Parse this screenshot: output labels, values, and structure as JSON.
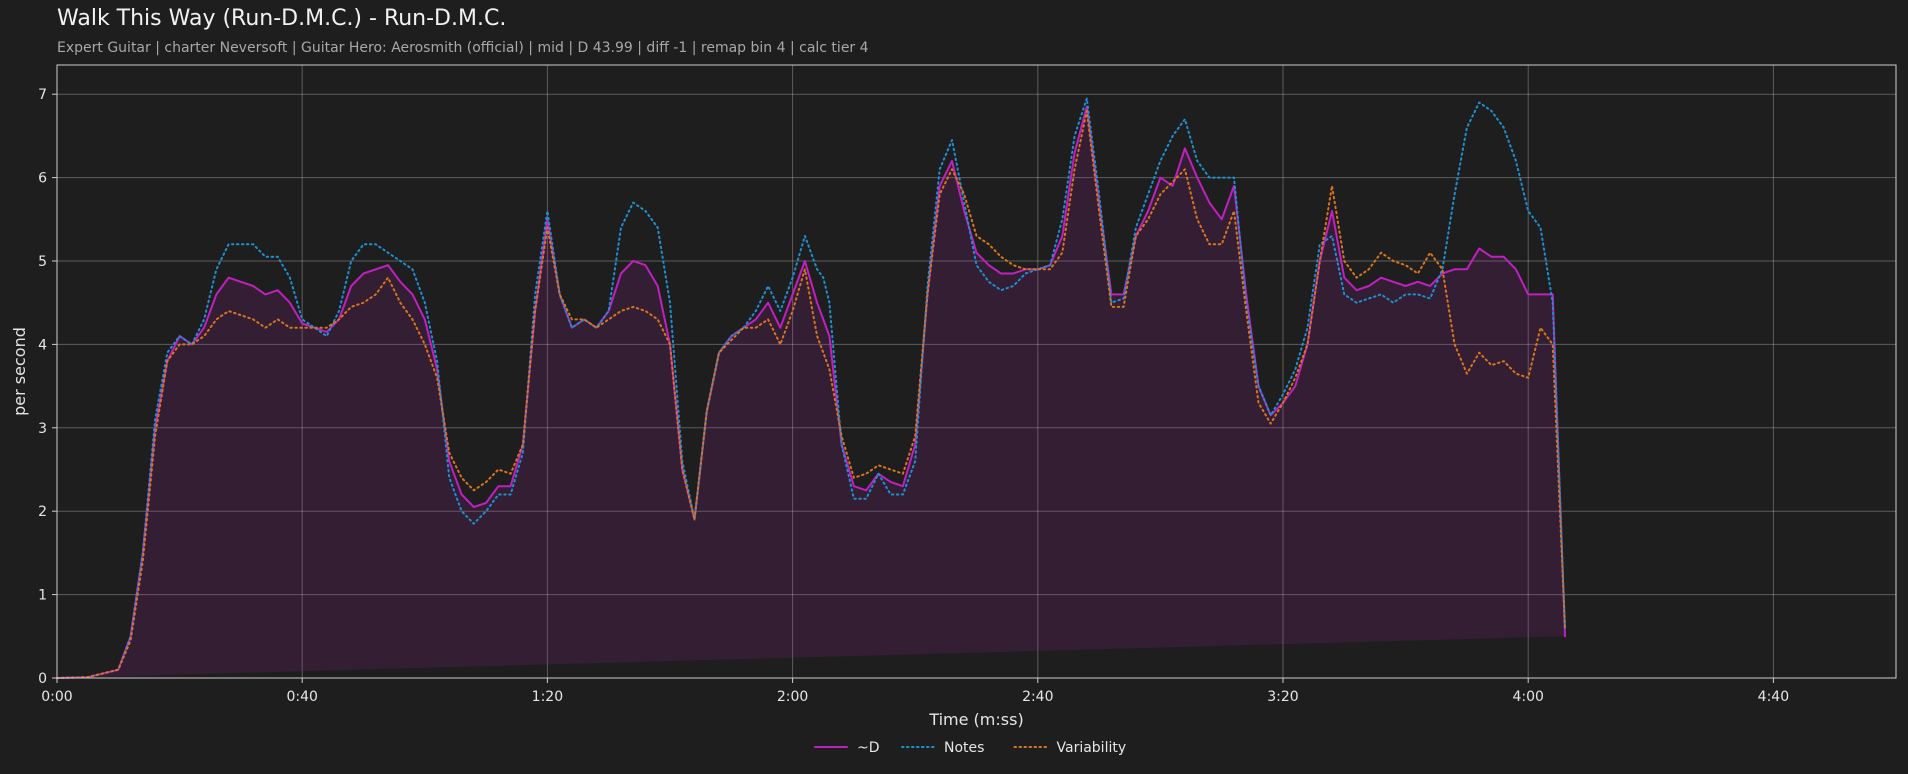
{
  "title": "Walk This Way (Run-D.M.C.) - Run-D.M.C.",
  "subtitle": "Expert Guitar  |  charter Neversoft  |  Guitar Hero: Aerosmith (official)  |  mid  |  D 43.99  |  diff -1  |  remap bin 4  |  calc tier 4",
  "chart_data": {
    "type": "line",
    "xlabel": "Time (m:ss)",
    "ylabel": "per second",
    "xlim": [
      0,
      300
    ],
    "ylim": [
      0,
      7.35
    ],
    "xticks": [
      0,
      40,
      80,
      120,
      160,
      200,
      240,
      280
    ],
    "xtick_labels": [
      "0:00",
      "0:40",
      "1:20",
      "2:00",
      "2:40",
      "3:20",
      "4:00",
      "4:40"
    ],
    "yticks": [
      0,
      1,
      2,
      3,
      4,
      5,
      6,
      7
    ],
    "ytick_labels": [
      "0",
      "1",
      "2",
      "3",
      "4",
      "5",
      "6",
      "7"
    ],
    "grid": true,
    "legend": "bottom-center",
    "x": [
      0,
      5,
      10,
      12,
      14,
      16,
      18,
      20,
      22,
      24,
      26,
      28,
      30,
      32,
      34,
      36,
      38,
      40,
      42,
      44,
      46,
      48,
      50,
      52,
      54,
      56,
      58,
      60,
      62,
      64,
      66,
      68,
      70,
      72,
      74,
      76,
      78,
      80,
      82,
      84,
      86,
      88,
      90,
      92,
      94,
      96,
      98,
      100,
      102,
      104,
      106,
      108,
      110,
      112,
      114,
      116,
      118,
      120,
      122,
      124,
      125,
      126,
      128,
      130,
      132,
      134,
      136,
      138,
      140,
      142,
      144,
      146,
      148,
      150,
      152,
      154,
      156,
      158,
      160,
      162,
      164,
      166,
      168,
      170,
      172,
      174,
      176,
      178,
      180,
      182,
      184,
      186,
      188,
      190,
      192,
      194,
      196,
      198,
      200,
      202,
      204,
      206,
      208,
      210,
      212,
      214,
      216,
      218,
      220,
      222,
      224,
      226,
      228,
      230,
      232,
      234,
      236,
      238,
      240,
      242,
      244,
      246,
      248,
      250,
      252,
      254,
      256,
      258,
      260,
      262,
      264,
      266,
      268,
      270,
      272,
      274,
      276,
      278,
      280,
      282,
      284,
      286,
      288,
      290,
      292,
      294,
      296,
      298,
      300
    ],
    "series": [
      {
        "name": "~D",
        "color": "#c020c0",
        "style": "solid",
        "fill": true,
        "values": [
          0,
          0.01,
          0.1,
          0.5,
          1.5,
          3.0,
          3.8,
          4.1,
          4.0,
          4.2,
          4.6,
          4.8,
          4.75,
          4.7,
          4.6,
          4.65,
          4.5,
          4.25,
          4.2,
          4.15,
          4.3,
          4.7,
          4.85,
          4.9,
          4.95,
          4.75,
          4.6,
          4.3,
          3.7,
          2.6,
          2.2,
          2.05,
          2.1,
          2.3,
          2.3,
          2.8,
          4.4,
          5.5,
          4.6,
          4.2,
          4.3,
          4.2,
          4.4,
          4.85,
          5.0,
          4.95,
          4.7,
          4.0,
          2.5,
          1.9,
          3.2,
          3.9,
          4.1,
          4.2,
          4.3,
          4.5,
          4.2,
          4.6,
          5.0,
          4.5,
          4.3,
          4.1,
          2.8,
          2.3,
          2.25,
          2.45,
          2.35,
          2.3,
          2.8,
          4.6,
          5.9,
          6.2,
          5.6,
          5.1,
          4.95,
          4.85,
          4.85,
          4.9,
          4.9,
          4.95,
          5.3,
          6.3,
          6.85,
          5.7,
          4.6,
          4.6,
          5.3,
          5.6,
          6.0,
          5.9,
          6.35,
          6.0,
          5.7,
          5.5,
          5.9,
          4.6,
          3.5,
          3.15,
          3.3,
          3.5,
          4.0,
          5.0,
          5.6,
          4.8,
          4.65,
          4.7,
          4.8,
          4.75,
          4.7,
          4.75,
          4.7,
          4.85,
          4.9,
          4.9,
          5.15,
          5.05,
          5.05,
          4.9,
          4.6,
          4.6,
          4.6,
          0.5
        ]
      },
      {
        "name": "Notes",
        "color": "#1f8fd0",
        "style": "dotted",
        "fill": false,
        "values": [
          0,
          0.01,
          0.1,
          0.5,
          1.5,
          3.1,
          3.9,
          4.1,
          4.0,
          4.3,
          4.9,
          5.2,
          5.2,
          5.2,
          5.05,
          5.05,
          4.8,
          4.3,
          4.2,
          4.1,
          4.4,
          5.0,
          5.2,
          5.2,
          5.1,
          5.0,
          4.9,
          4.5,
          3.8,
          2.4,
          2.0,
          1.85,
          2.0,
          2.2,
          2.2,
          2.7,
          4.6,
          5.6,
          4.6,
          4.2,
          4.3,
          4.2,
          4.4,
          5.4,
          5.7,
          5.6,
          5.4,
          4.5,
          2.6,
          1.9,
          3.2,
          3.9,
          4.1,
          4.2,
          4.4,
          4.7,
          4.4,
          4.8,
          5.3,
          4.9,
          4.8,
          4.5,
          2.8,
          2.15,
          2.15,
          2.45,
          2.2,
          2.2,
          2.6,
          4.7,
          6.1,
          6.45,
          5.7,
          4.95,
          4.75,
          4.65,
          4.7,
          4.85,
          4.9,
          4.95,
          5.5,
          6.5,
          6.95,
          5.8,
          4.5,
          4.55,
          5.4,
          5.8,
          6.2,
          6.5,
          6.7,
          6.2,
          6.0,
          6.0,
          6.0,
          4.5,
          3.5,
          3.15,
          3.4,
          3.7,
          4.2,
          5.2,
          5.3,
          4.6,
          4.5,
          4.55,
          4.6,
          4.5,
          4.6,
          4.6,
          4.55,
          4.9,
          5.8,
          6.6,
          6.9,
          6.8,
          6.6,
          6.2,
          5.6,
          5.4,
          4.5,
          0.6
        ]
      },
      {
        "name": "Variability",
        "color": "#d8751f",
        "style": "dotted",
        "fill": false,
        "values": [
          0,
          0.01,
          0.1,
          0.45,
          1.4,
          2.9,
          3.8,
          4.0,
          4.0,
          4.1,
          4.3,
          4.4,
          4.35,
          4.3,
          4.2,
          4.3,
          4.2,
          4.2,
          4.2,
          4.2,
          4.3,
          4.45,
          4.5,
          4.6,
          4.8,
          4.5,
          4.3,
          4.0,
          3.6,
          2.7,
          2.4,
          2.25,
          2.35,
          2.5,
          2.45,
          2.8,
          4.4,
          5.4,
          4.6,
          4.3,
          4.3,
          4.2,
          4.3,
          4.4,
          4.45,
          4.4,
          4.3,
          4.0,
          2.5,
          1.9,
          3.2,
          3.9,
          4.05,
          4.2,
          4.2,
          4.3,
          4.0,
          4.4,
          4.9,
          4.1,
          3.9,
          3.7,
          2.9,
          2.4,
          2.45,
          2.55,
          2.5,
          2.45,
          2.9,
          4.6,
          5.8,
          6.1,
          5.8,
          5.3,
          5.2,
          5.05,
          4.95,
          4.9,
          4.9,
          4.9,
          5.1,
          6.1,
          6.8,
          5.6,
          4.45,
          4.45,
          5.3,
          5.5,
          5.8,
          5.95,
          6.1,
          5.5,
          5.2,
          5.2,
          5.6,
          4.4,
          3.3,
          3.05,
          3.3,
          3.6,
          4.0,
          5.0,
          5.9,
          5.0,
          4.8,
          4.9,
          5.1,
          5.0,
          4.95,
          4.85,
          5.1,
          4.9,
          4.0,
          3.65,
          3.9,
          3.75,
          3.8,
          3.65,
          3.6,
          4.2,
          4.0,
          0.6
        ]
      }
    ]
  }
}
